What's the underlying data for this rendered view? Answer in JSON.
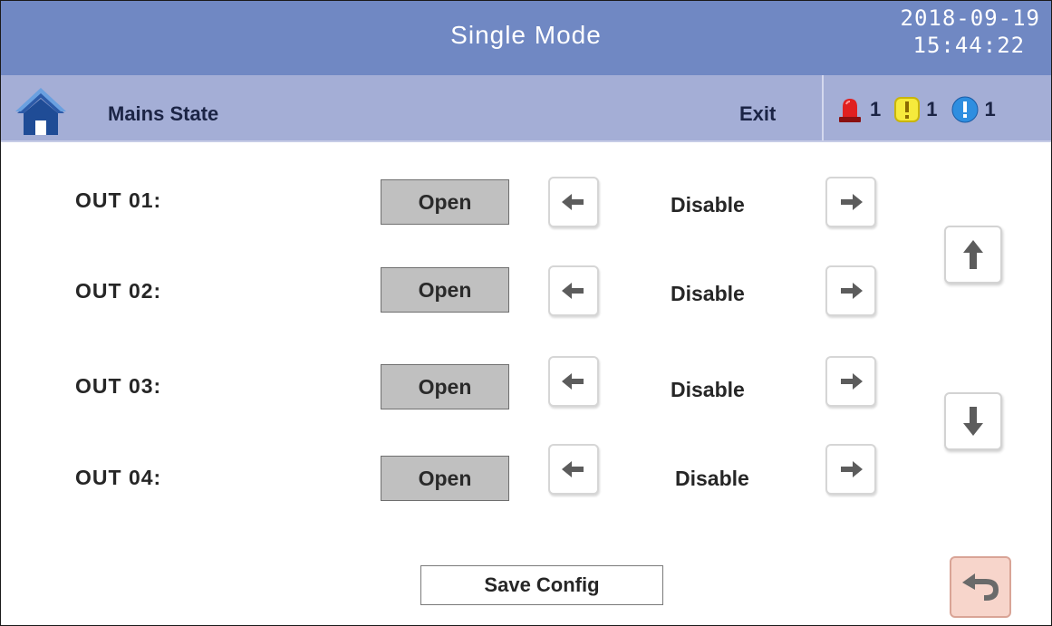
{
  "header": {
    "title": "Single Mode",
    "date": "2018-09-19",
    "time": "15:44:22"
  },
  "subheader": {
    "section_title": "Mains State",
    "exit_label": "Exit",
    "alarms": [
      {
        "icon": "red-alarm-light-icon",
        "count": "1",
        "color": "#e02020"
      },
      {
        "icon": "yellow-warning-icon",
        "count": "1",
        "color": "#f6ea3c"
      },
      {
        "icon": "blue-info-icon",
        "count": "1",
        "color": "#2e8ee0"
      }
    ]
  },
  "outputs": [
    {
      "label": "OUT 01:",
      "button": "Open",
      "state": "Disable"
    },
    {
      "label": "OUT 02:",
      "button": "Open",
      "state": "Disable"
    },
    {
      "label": "OUT 03:",
      "button": "Open",
      "state": "Disable"
    },
    {
      "label": "OUT 04:",
      "button": "Open",
      "state": "Disable"
    }
  ],
  "footer": {
    "save_label": "Save Config"
  },
  "icons": {
    "home": "home-icon",
    "prev": "arrow-left-icon",
    "next": "arrow-right-icon",
    "scroll_up": "arrow-up-icon",
    "scroll_down": "arrow-down-icon",
    "back": "return-icon"
  },
  "colors": {
    "title_bar": "#7088c3",
    "sub_bar": "#a4aed6",
    "button_gray": "#c0c0c0",
    "back_button": "#f7d5cb"
  }
}
